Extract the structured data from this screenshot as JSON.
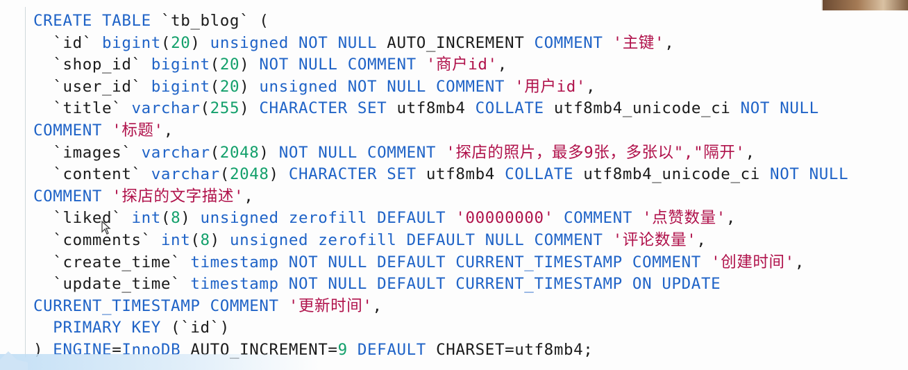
{
  "code": {
    "lines": [
      [
        {
          "t": "CREATE TABLE",
          "c": "k"
        },
        {
          "t": " `tb_blog` (",
          "c": "i"
        }
      ],
      [
        {
          "t": "  `id` ",
          "c": "i"
        },
        {
          "t": "bigint",
          "c": "k"
        },
        {
          "t": "(",
          "c": "p"
        },
        {
          "t": "20",
          "c": "n"
        },
        {
          "t": ") ",
          "c": "p"
        },
        {
          "t": "unsigned NOT NULL",
          "c": "k"
        },
        {
          "t": " AUTO_INCREMENT ",
          "c": "i"
        },
        {
          "t": "COMMENT",
          "c": "k"
        },
        {
          "t": " ",
          "c": "p"
        },
        {
          "t": "'主键'",
          "c": "s"
        },
        {
          "t": ",",
          "c": "p"
        }
      ],
      [
        {
          "t": "  `shop_id` ",
          "c": "i"
        },
        {
          "t": "bigint",
          "c": "k"
        },
        {
          "t": "(",
          "c": "p"
        },
        {
          "t": "20",
          "c": "n"
        },
        {
          "t": ") ",
          "c": "p"
        },
        {
          "t": "NOT NULL COMMENT",
          "c": "k"
        },
        {
          "t": " ",
          "c": "p"
        },
        {
          "t": "'商户id'",
          "c": "s"
        },
        {
          "t": ",",
          "c": "p"
        }
      ],
      [
        {
          "t": "  `user_id` ",
          "c": "i"
        },
        {
          "t": "bigint",
          "c": "k"
        },
        {
          "t": "(",
          "c": "p"
        },
        {
          "t": "20",
          "c": "n"
        },
        {
          "t": ") ",
          "c": "p"
        },
        {
          "t": "unsigned NOT NULL COMMENT",
          "c": "k"
        },
        {
          "t": " ",
          "c": "p"
        },
        {
          "t": "'用户id'",
          "c": "s"
        },
        {
          "t": ",",
          "c": "p"
        }
      ],
      [
        {
          "t": "  `title` ",
          "c": "i"
        },
        {
          "t": "varchar",
          "c": "k"
        },
        {
          "t": "(",
          "c": "p"
        },
        {
          "t": "255",
          "c": "n"
        },
        {
          "t": ") ",
          "c": "p"
        },
        {
          "t": "CHARACTER SET",
          "c": "k"
        },
        {
          "t": " utf8mb4 ",
          "c": "i"
        },
        {
          "t": "COLLATE",
          "c": "k"
        },
        {
          "t": " utf8mb4_unicode_ci ",
          "c": "i"
        },
        {
          "t": "NOT NULL",
          "c": "k"
        }
      ],
      [
        {
          "t": "COMMENT",
          "c": "k"
        },
        {
          "t": " ",
          "c": "p"
        },
        {
          "t": "'标题'",
          "c": "s"
        },
        {
          "t": ",",
          "c": "p"
        }
      ],
      [
        {
          "t": "  `images` ",
          "c": "i"
        },
        {
          "t": "varchar",
          "c": "k"
        },
        {
          "t": "(",
          "c": "p"
        },
        {
          "t": "2048",
          "c": "n"
        },
        {
          "t": ") ",
          "c": "p"
        },
        {
          "t": "NOT NULL COMMENT",
          "c": "k"
        },
        {
          "t": " ",
          "c": "p"
        },
        {
          "t": "'探店的照片，最多9张，多张以\",\"隔开'",
          "c": "s"
        },
        {
          "t": ",",
          "c": "p"
        }
      ],
      [
        {
          "t": "  `content` ",
          "c": "i"
        },
        {
          "t": "varchar",
          "c": "k"
        },
        {
          "t": "(",
          "c": "p"
        },
        {
          "t": "2048",
          "c": "n"
        },
        {
          "t": ") ",
          "c": "p"
        },
        {
          "t": "CHARACTER SET",
          "c": "k"
        },
        {
          "t": " utf8mb4 ",
          "c": "i"
        },
        {
          "t": "COLLATE",
          "c": "k"
        },
        {
          "t": " utf8mb4_unicode_ci ",
          "c": "i"
        },
        {
          "t": "NOT NULL",
          "c": "k"
        }
      ],
      [
        {
          "t": "COMMENT",
          "c": "k"
        },
        {
          "t": " ",
          "c": "p"
        },
        {
          "t": "'探店的文字描述'",
          "c": "s"
        },
        {
          "t": ",",
          "c": "p"
        }
      ],
      [
        {
          "t": "  `liked` ",
          "c": "i"
        },
        {
          "t": "int",
          "c": "k"
        },
        {
          "t": "(",
          "c": "p"
        },
        {
          "t": "8",
          "c": "n"
        },
        {
          "t": ") ",
          "c": "p"
        },
        {
          "t": "unsigned zerofill DEFAULT",
          "c": "k"
        },
        {
          "t": " ",
          "c": "p"
        },
        {
          "t": "'00000000'",
          "c": "s"
        },
        {
          "t": " ",
          "c": "p"
        },
        {
          "t": "COMMENT",
          "c": "k"
        },
        {
          "t": " ",
          "c": "p"
        },
        {
          "t": "'点赞数量'",
          "c": "s"
        },
        {
          "t": ",",
          "c": "p"
        }
      ],
      [
        {
          "t": "  `comments` ",
          "c": "i"
        },
        {
          "t": "int",
          "c": "k"
        },
        {
          "t": "(",
          "c": "p"
        },
        {
          "t": "8",
          "c": "n"
        },
        {
          "t": ") ",
          "c": "p"
        },
        {
          "t": "unsigned zerofill DEFAULT NULL COMMENT",
          "c": "k"
        },
        {
          "t": " ",
          "c": "p"
        },
        {
          "t": "'评论数量'",
          "c": "s"
        },
        {
          "t": ",",
          "c": "p"
        }
      ],
      [
        {
          "t": "  `create_time` ",
          "c": "i"
        },
        {
          "t": "timestamp NOT NULL DEFAULT CURRENT_TIMESTAMP COMMENT",
          "c": "k"
        },
        {
          "t": " ",
          "c": "p"
        },
        {
          "t": "'创建时间'",
          "c": "s"
        },
        {
          "t": ",",
          "c": "p"
        }
      ],
      [
        {
          "t": "  `update_time` ",
          "c": "i"
        },
        {
          "t": "timestamp NOT NULL DEFAULT CURRENT_TIMESTAMP ON UPDATE",
          "c": "k"
        }
      ],
      [
        {
          "t": "CURRENT_TIMESTAMP COMMENT",
          "c": "k"
        },
        {
          "t": " ",
          "c": "p"
        },
        {
          "t": "'更新时间'",
          "c": "s"
        },
        {
          "t": ",",
          "c": "p"
        }
      ],
      [
        {
          "t": "  ",
          "c": "p"
        },
        {
          "t": "PRIMARY KEY",
          "c": "k"
        },
        {
          "t": " (`id`)",
          "c": "i"
        }
      ],
      [
        {
          "t": ") ",
          "c": "p"
        },
        {
          "t": "ENGINE",
          "c": "k"
        },
        {
          "t": "=",
          "c": "p"
        },
        {
          "t": "InnoDB",
          "c": "k"
        },
        {
          "t": " AUTO_INCREMENT=",
          "c": "i"
        },
        {
          "t": "9",
          "c": "n"
        },
        {
          "t": " ",
          "c": "p"
        },
        {
          "t": "DEFAULT",
          "c": "k"
        },
        {
          "t": " CHARSET=utf8mb4;",
          "c": "i"
        }
      ]
    ]
  },
  "colors": {
    "keyword": "#1f63c7",
    "string": "#b0124b",
    "number": "#13a06b",
    "identifier": "#1b1b1b",
    "background": "#fdfdfd"
  },
  "icons": {
    "cursor": "mouse-pointer-icon"
  }
}
